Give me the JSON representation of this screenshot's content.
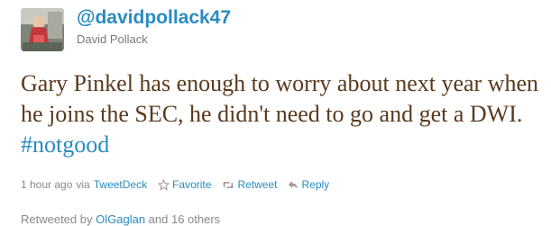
{
  "author": {
    "handle": "@davidpollack47",
    "name": "David Pollack"
  },
  "tweet": {
    "text": "Gary Pinkel has enough to worry about next year when he joins the SEC, he didn't need to go and get a DWI.",
    "hashtag": "#notgood"
  },
  "meta": {
    "time": "1 hour ago",
    "via_prefix": "via",
    "client": "TweetDeck"
  },
  "actions": {
    "favorite": "Favorite",
    "retweet": "Retweet",
    "reply": "Reply"
  },
  "retweeted": {
    "prefix": "Retweeted by",
    "user": "OlGaglan",
    "suffix": "and 16 others"
  },
  "colors": {
    "link": "#2a8bc2",
    "tweet_text": "#5a3a1c",
    "muted": "#8a8a8a"
  },
  "icons": [
    "avatar-photo",
    "star-icon",
    "retweet-icon",
    "reply-icon"
  ]
}
